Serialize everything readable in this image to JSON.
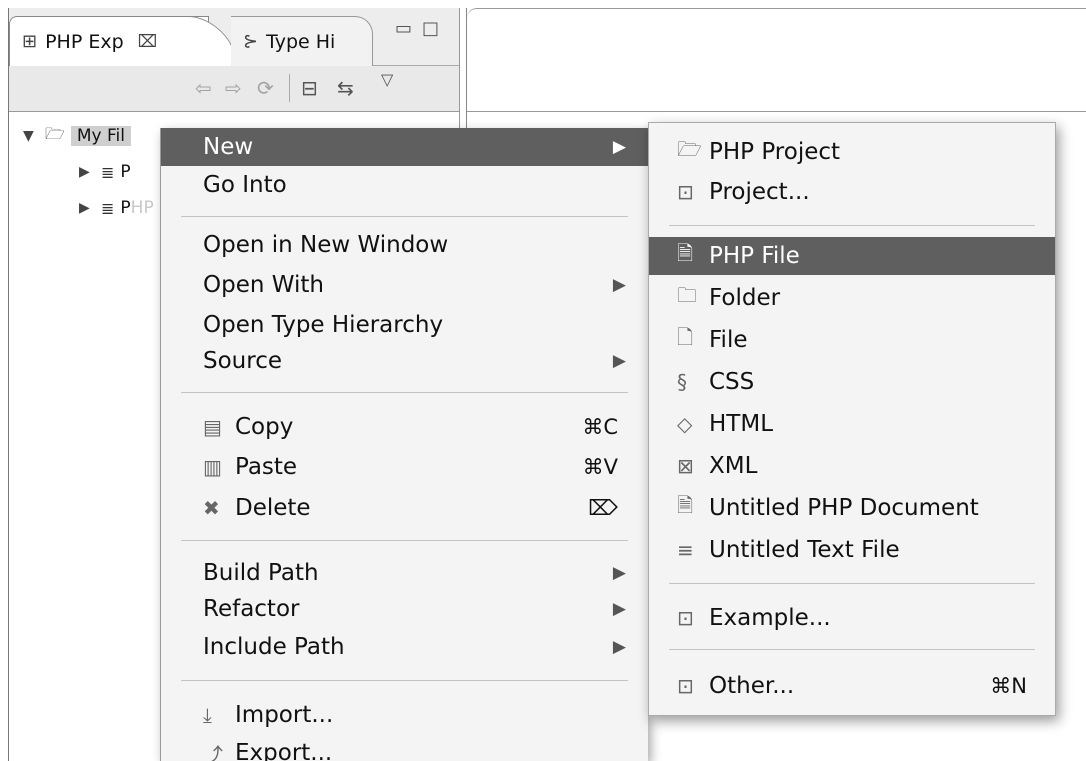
{
  "explorer": {
    "tabs": [
      {
        "label": "PHP Exp",
        "icon": "php-explorer-icon",
        "close": "⌧"
      },
      {
        "label": "Type Hi",
        "icon": "type-hierarchy-icon"
      }
    ],
    "toolbar_icons": [
      "back-arrow-icon",
      "forward-arrow-icon",
      "up-folder-icon",
      "collapse-all-icon",
      "link-with-editor-icon",
      "view-menu-icon"
    ],
    "tree": {
      "root_label": "My Fil",
      "child1_prefix": "P",
      "child1_ghost": "",
      "child2_prefix": "P",
      "child2_ghost": "HP Language Library"
    }
  },
  "context_menu": {
    "items": [
      {
        "label": "New",
        "submenu": true,
        "highlighted": true
      },
      {
        "label": "Go Into"
      },
      {
        "label": "Open in New Window"
      },
      {
        "label": "Open With",
        "submenu": true
      },
      {
        "label": "Open Type Hierarchy"
      },
      {
        "label": "Source",
        "submenu": true
      },
      {
        "label": "Copy",
        "shortcut": "⌘C",
        "icon": "copy-icon"
      },
      {
        "label": "Paste",
        "shortcut": "⌘V",
        "icon": "paste-icon"
      },
      {
        "label": "Delete",
        "shortcut": "⌦",
        "icon": "delete-icon"
      },
      {
        "label": "Build Path",
        "submenu": true
      },
      {
        "label": "Refactor",
        "submenu": true
      },
      {
        "label": "Include Path",
        "submenu": true
      },
      {
        "label": "Import...",
        "icon": "import-icon"
      },
      {
        "label": "Export...",
        "icon": "export-icon"
      }
    ]
  },
  "new_submenu": {
    "items": [
      {
        "label": "PHP Project",
        "icon": "php-project-icon"
      },
      {
        "label": "Project...",
        "icon": "new-project-icon"
      },
      {
        "label": "PHP File",
        "icon": "php-file-icon",
        "highlighted": true
      },
      {
        "label": "Folder",
        "icon": "folder-icon"
      },
      {
        "label": "File",
        "icon": "file-icon"
      },
      {
        "label": "CSS",
        "icon": "css-file-icon"
      },
      {
        "label": "HTML",
        "icon": "html-file-icon"
      },
      {
        "label": "XML",
        "icon": "xml-file-icon"
      },
      {
        "label": "Untitled PHP Document",
        "icon": "untitled-php-icon"
      },
      {
        "label": "Untitled Text File",
        "icon": "untitled-text-icon"
      },
      {
        "label": "Example...",
        "icon": "example-icon"
      },
      {
        "label": "Other...",
        "shortcut": "⌘N",
        "icon": "other-wizard-icon"
      }
    ]
  },
  "colors": {
    "highlight": "#5f5f5f",
    "menu_bg": "#f4f4f4"
  }
}
